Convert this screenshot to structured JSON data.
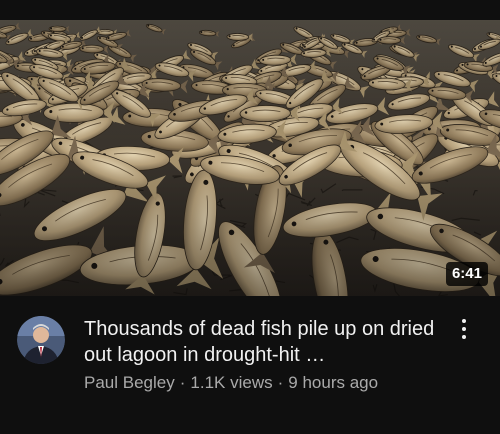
{
  "video": {
    "duration": "6:41",
    "title": "Thousands of dead fish pile up on dried out lagoon in drought-hit …",
    "channel": "Paul Begley",
    "views": "1.1K views",
    "age": "9 hours ago",
    "separator": "·",
    "thumbnail_subject": "dead fish on cracked dry lagoon bed",
    "menu_icon": "more-vert-icon"
  },
  "colors": {
    "background": "#0f0f0f",
    "title_text": "#f1f1f1",
    "secondary_text": "#aaaaaa",
    "badge_bg": "#000000"
  }
}
